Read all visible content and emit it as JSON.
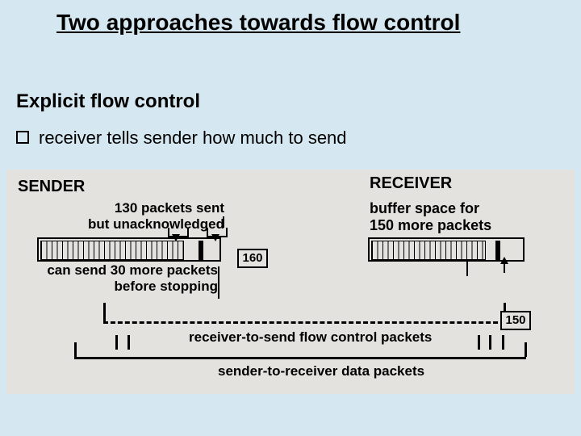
{
  "title": "Two approaches towards flow control",
  "section": "Explicit flow control",
  "bullet": "receiver tells sender how much to send",
  "diagram": {
    "sender_label": "SENDER",
    "receiver_label": "RECEIVER",
    "sender_pkts_text": "130 packets sent\nbut unacknowledged",
    "receiver_buffer_text": "buffer space for\n150 more packets",
    "can_send_text": "can send 30 more packets\nbefore stopping",
    "value_160": "160",
    "value_150": "150",
    "flow_pkts_label": "receiver-to-send flow control packets",
    "data_pkts_label": "sender-to-receiver data packets"
  }
}
